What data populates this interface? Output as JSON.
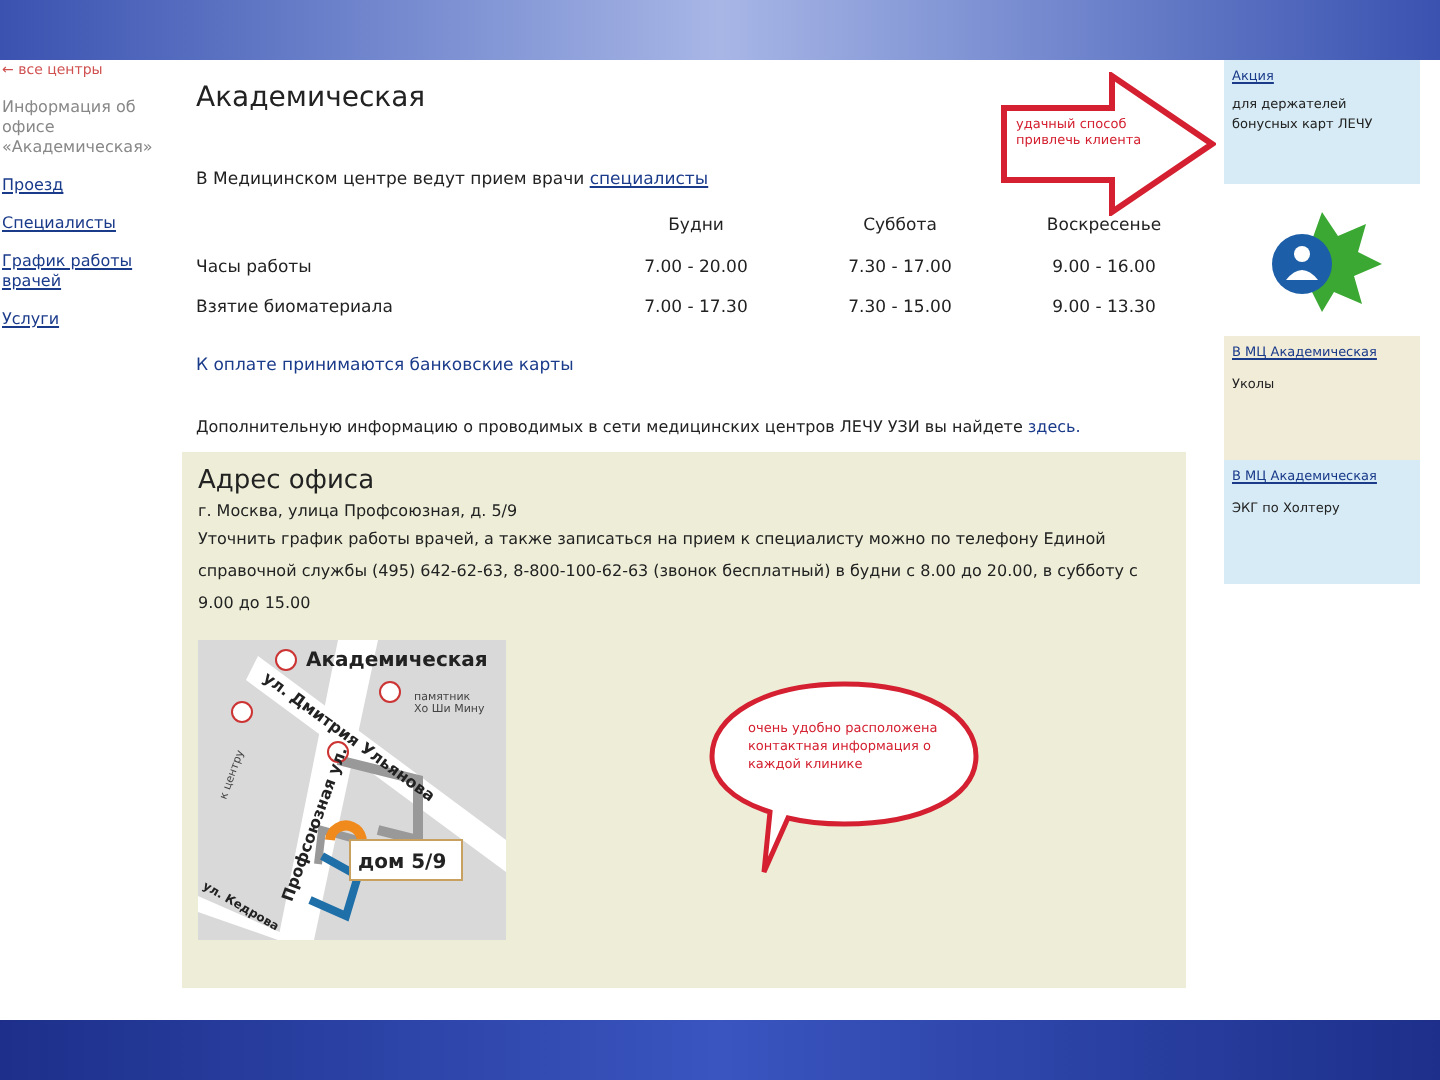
{
  "sidebar": {
    "back_link": "← все центры",
    "items": [
      {
        "label": "Информация об офисе «Академическая»",
        "selected": true
      },
      {
        "label": "Проезд",
        "selected": false
      },
      {
        "label": "Специалисты",
        "selected": false
      },
      {
        "label": "График работы врачей",
        "selected": false
      },
      {
        "label": "Услуги",
        "selected": false
      }
    ]
  },
  "page": {
    "title": "Академическая",
    "intro": "В Медицинском центре ведут прием врачи",
    "intro_link": "специалисты",
    "schedule": {
      "columns": [
        "Будни",
        "Суббота",
        "Воскресенье"
      ],
      "rows": [
        {
          "label": "Часы работы",
          "cells": [
            "7.00 - 20.00",
            "7.30 - 17.00",
            "9.00 - 16.00"
          ]
        },
        {
          "label": "Взятие биоматериала",
          "cells": [
            "7.00 - 17.30",
            "7.30 - 15.00",
            "9.00 - 13.30"
          ]
        }
      ]
    },
    "payment_note": "К оплате принимаются банковские карты",
    "more_info": "Дополнительную информацию о проводимых в сети медицинских центров ЛЕЧУ УЗИ вы найдете",
    "more_info_link": "здесь."
  },
  "address": {
    "title": "Адрес офиса",
    "street": "г. Москва, улица Профсоюзная, д. 5/9",
    "details": "Уточнить график работы врачей, а также записаться на прием к специалисту можно по телефону Единой справочной службы (495) 642-62-63, 8-800-100-62-63 (звонок бесплатный) в будни с 8.00 до 20.00, в субботу с 9.00 до 15.00",
    "map": {
      "station": "Академическая",
      "monument": "памятник Хо Ши Мину",
      "street_1": "ул. Дмитрия Ульянова",
      "street_2": "Профсоюзная ул.",
      "street_3": "ул. Кедрова",
      "direction": "к центру",
      "house": "дом 5/9"
    }
  },
  "right_panel": {
    "promo": {
      "link": "Акция",
      "text": "для держателей бонусных карт ЛЕЧУ"
    },
    "offers": [
      {
        "link": "В МЦ Академическая",
        "text": "Уколы",
        "color": "#f1ecd8"
      },
      {
        "link": "В МЦ Академическая",
        "text": "ЭКГ по Холтеру",
        "color": "#d6ebf5"
      }
    ]
  },
  "callouts": [
    {
      "kind": "arrow",
      "text": "удачный способ привлечь клиента"
    },
    {
      "kind": "bubble",
      "text": "очень удобно расположена контактная информация о каждой клинике"
    }
  ]
}
